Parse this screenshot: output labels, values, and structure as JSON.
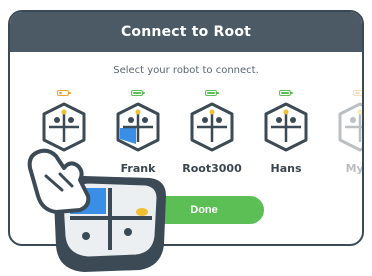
{
  "dialog": {
    "title": "Connect to Root",
    "subtitle": "Select your robot to connect.",
    "done_label": "Done"
  },
  "robots": [
    {
      "name": "",
      "battery_level": 0.25,
      "battery_color": "#f0a030",
      "selected": false
    },
    {
      "name": "Frank",
      "battery_level": 0.9,
      "battery_color": "#5cbf55",
      "selected": true
    },
    {
      "name": "Root3000",
      "battery_level": 0.9,
      "battery_color": "#5cbf55",
      "selected": false
    },
    {
      "name": "Hans",
      "battery_level": 0.9,
      "battery_color": "#5cbf55",
      "selected": false
    },
    {
      "name": "Myrt",
      "battery_level": 0.6,
      "battery_color": "#f0a030",
      "selected": false
    }
  ],
  "colors": {
    "header": "#4b5a65",
    "accent_green": "#5cbf55",
    "selected_blue": "#3a8ee6",
    "outline": "#3b4a55"
  },
  "icons": {
    "robot": "root-robot-icon",
    "hand": "pointing-hand-icon",
    "large_robot": "root-robot-icon-large"
  }
}
